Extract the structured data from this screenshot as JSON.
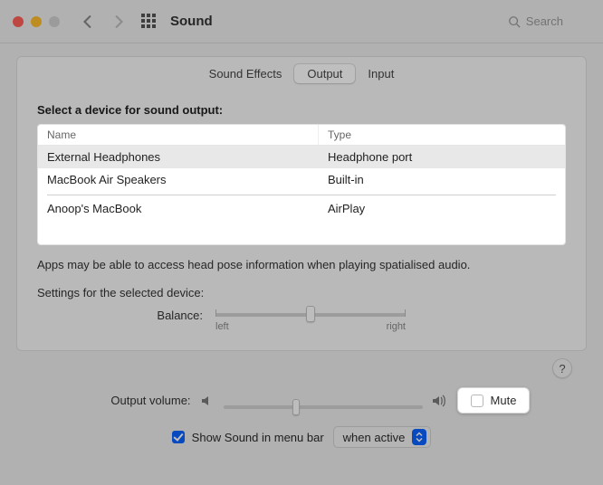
{
  "window": {
    "title": "Sound"
  },
  "search": {
    "placeholder": "Search"
  },
  "tabs": {
    "sound_effects": "Sound Effects",
    "output": "Output",
    "input": "Input"
  },
  "output": {
    "heading": "Select a device for sound output:",
    "columns": {
      "name": "Name",
      "type": "Type"
    },
    "devices": [
      {
        "name": "External Headphones",
        "type": "Headphone port",
        "selected": true
      },
      {
        "name": "MacBook Air Speakers",
        "type": "Built-in",
        "selected": false
      },
      {
        "name": "Anoop's MacBook",
        "type": "AirPlay",
        "selected": false,
        "group": "airplay"
      }
    ],
    "note": "Apps may be able to access head pose information when playing spatialised audio.",
    "settings_heading": "Settings for the selected device:",
    "balance": {
      "label": "Balance:",
      "left_label": "left",
      "right_label": "right",
      "value": 0.5
    }
  },
  "footer": {
    "output_volume_label": "Output volume:",
    "output_volume_value": 0.35,
    "mute_label": "Mute",
    "mute_checked": false,
    "show_in_menubar_label": "Show Sound in menu bar",
    "show_in_menubar_checked": true,
    "show_mode": "when active"
  },
  "icons": {
    "help": "?"
  }
}
